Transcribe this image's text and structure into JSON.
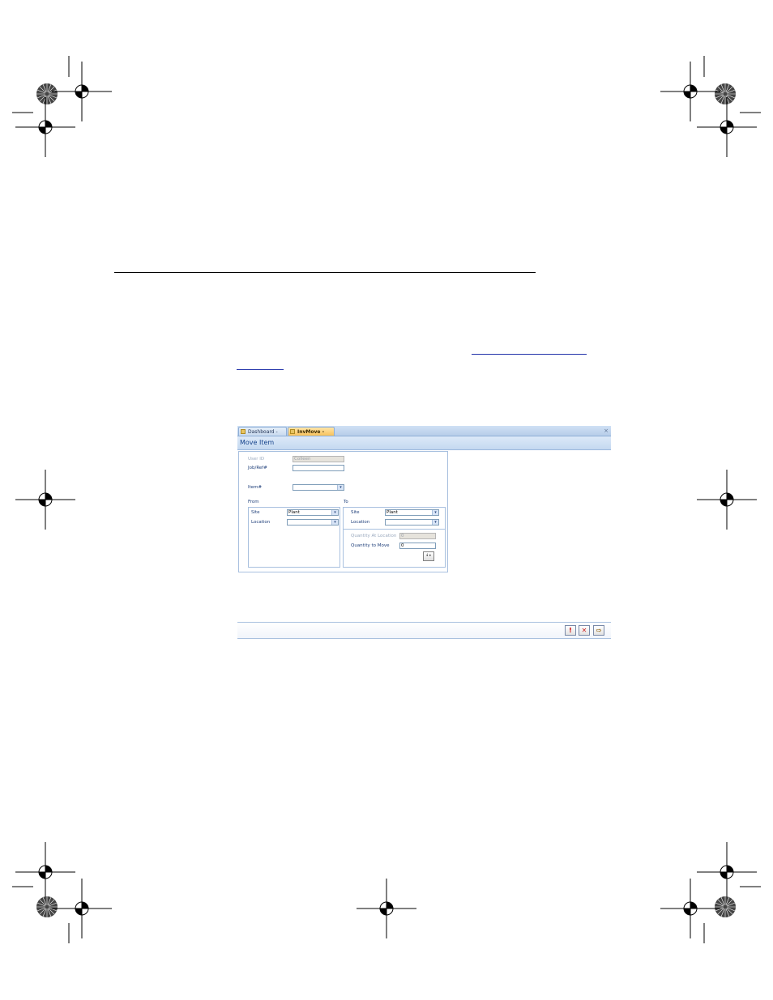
{
  "page": {
    "link_text_1": "",
    "link_text_2": ""
  },
  "app": {
    "tabs": [
      {
        "label": "Dashboard - DEMO",
        "active": false
      },
      {
        "label": "InvMove - DEMO",
        "active": true
      }
    ],
    "close_glyph": "×",
    "form_title": "Move Item",
    "user_id": {
      "label": "User ID",
      "value": "Colleen"
    },
    "job_ref": {
      "label": "Job/Ref#",
      "value": ""
    },
    "item": {
      "label": "Item#",
      "value": ""
    },
    "from": {
      "label": "From",
      "site": {
        "label": "Site",
        "value": "Plant"
      },
      "location": {
        "label": "Location",
        "value": ""
      }
    },
    "to": {
      "label": "To",
      "site": {
        "label": "Site",
        "value": "Plant"
      },
      "location": {
        "label": "Location",
        "value": ""
      },
      "qty_at_location": {
        "label": "Quantity At Location",
        "value": "0"
      },
      "qty_to_move": {
        "label": "Quantity to Move",
        "value": "0"
      }
    },
    "dropdown_glyph": "▾",
    "footer_buttons": [
      {
        "icon": "exclamation-icon",
        "glyph": "!",
        "color": "#cc0000"
      },
      {
        "icon": "close-x-icon",
        "glyph": "✕",
        "color": "#cc2222"
      },
      {
        "icon": "exit-door-icon",
        "glyph": "⇨",
        "color": "#8a5a00"
      }
    ]
  }
}
